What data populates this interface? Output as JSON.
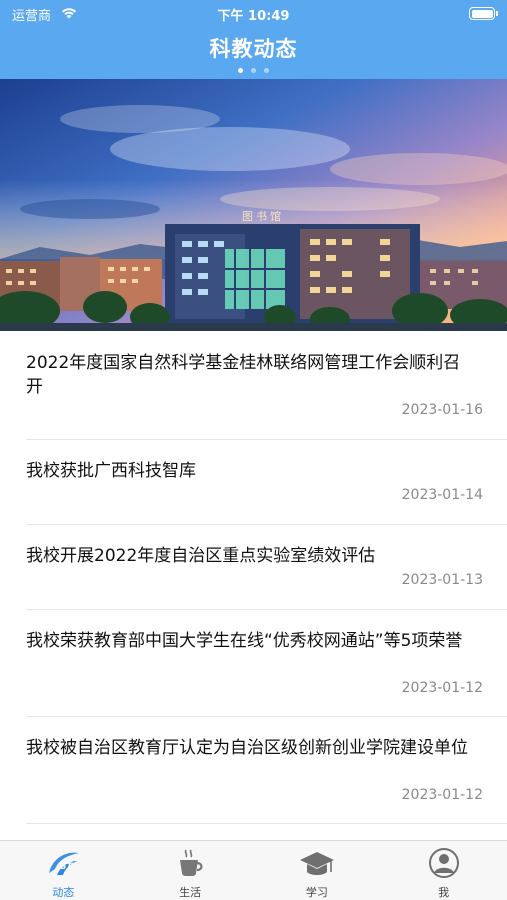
{
  "status_bar": {
    "carrier": "运营商",
    "time": "下午 10:49"
  },
  "header": {
    "title": "科教动态",
    "page_count": 3,
    "active_page": 1
  },
  "banner": {
    "building_sign": "图书馆"
  },
  "news": [
    {
      "title": "2022年度国家自然科学基金桂林联络网管理工作会顺利召开",
      "date": "2023-01-16"
    },
    {
      "title": "我校获批广西科技智库",
      "date": "2023-01-14"
    },
    {
      "title": "我校开展2022年度自治区重点实验室绩效评估",
      "date": "2023-01-13"
    },
    {
      "title": "我校荣获教育部中国大学生在线“优秀校网通站”等5项荣誉",
      "date": "2023-01-12"
    },
    {
      "title": "我校被自治区教育厅认定为自治区级创新创业学院建设单位",
      "date": "2023-01-12"
    }
  ],
  "tabbar": {
    "tabs": [
      {
        "label": "动态",
        "icon": "logo-icon",
        "active": true
      },
      {
        "label": "生活",
        "icon": "coffee-cup-icon",
        "active": false
      },
      {
        "label": "学习",
        "icon": "graduation-cap-icon",
        "active": false
      },
      {
        "label": "我",
        "icon": "person-icon",
        "active": false
      }
    ]
  },
  "colors": {
    "header_bg": "#5aa9f0",
    "tab_active": "#2b86e8",
    "date_text": "#8a8a8a"
  }
}
